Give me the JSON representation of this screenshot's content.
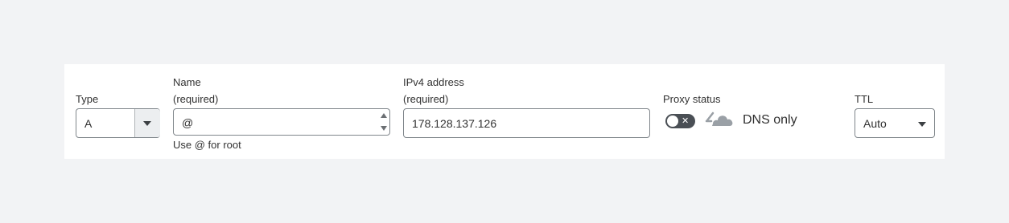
{
  "type": {
    "label": "Type",
    "value": "A"
  },
  "name": {
    "label": "Name",
    "required": "(required)",
    "value": "@",
    "hint": "Use @ for root"
  },
  "ipv4": {
    "label": "IPv4 address",
    "required": "(required)",
    "value": "178.128.137.126"
  },
  "proxy": {
    "label": "Proxy status",
    "toggle_enabled": false,
    "toggle_glyph": "✕",
    "state_label": "DNS only"
  },
  "ttl": {
    "label": "TTL",
    "value": "Auto"
  },
  "colors": {
    "panel": "#ffffff",
    "background": "#f2f3f5",
    "toggle_off": "#4a4f55",
    "cloud": "#9aa0a6"
  }
}
